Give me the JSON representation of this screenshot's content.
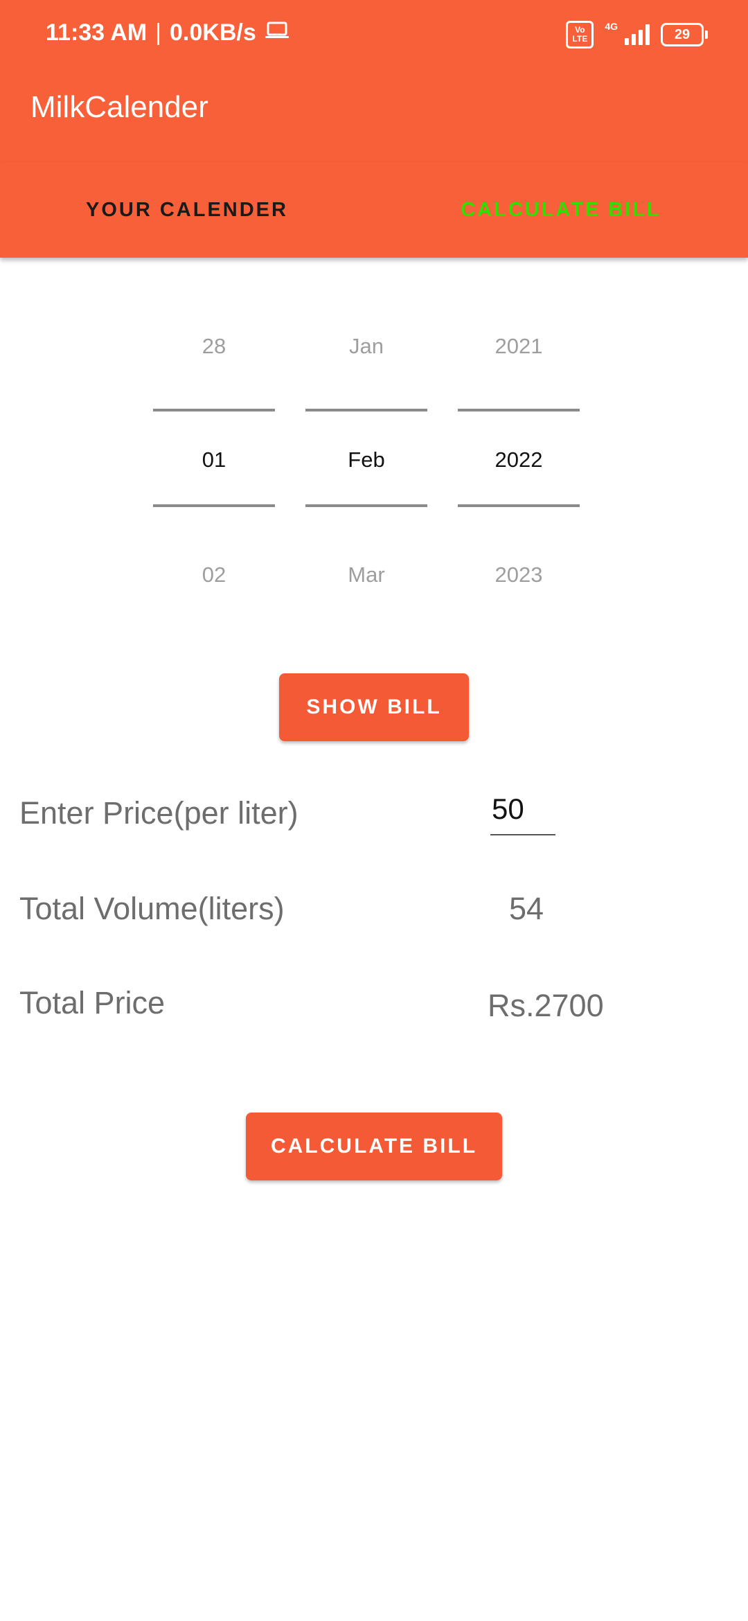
{
  "status_bar": {
    "time": "11:33 AM",
    "separator": "|",
    "speed": "0.0KB/s",
    "volte_top": "Vo",
    "volte_bottom": "LTE",
    "network": "4G",
    "battery": "29"
  },
  "app": {
    "title": "MilkCalender"
  },
  "tabs": [
    {
      "label": "YOUR CALENDER",
      "selected": false
    },
    {
      "label": "CALCULATE BILL",
      "selected": true,
      "color": "#33dd00"
    }
  ],
  "date_picker": {
    "day": {
      "prev": "28",
      "current": "01",
      "next": "02"
    },
    "month": {
      "prev": "Jan",
      "current": "Feb",
      "next": "Mar"
    },
    "year": {
      "prev": "2021",
      "current": "2022",
      "next": "2023"
    }
  },
  "buttons": {
    "show_bill": "SHOW BILL",
    "calculate_bill": "CALCULATE BILL"
  },
  "form": {
    "price_label": "Enter Price(per liter)",
    "price_value": "50",
    "volume_label": "Total Volume(liters)",
    "volume_value": "54",
    "total_label": "Total Price",
    "total_value": "Rs.2700"
  },
  "colors": {
    "accent": "#F76039",
    "tab_selected": "#33dd00"
  }
}
